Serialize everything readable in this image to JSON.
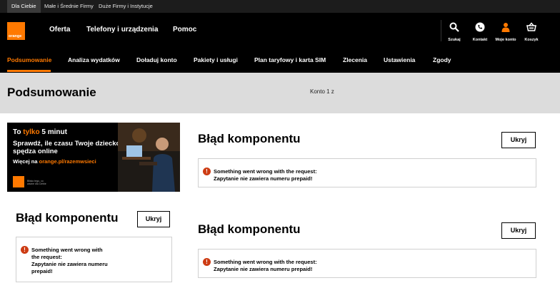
{
  "top_bar": {
    "segments": [
      "Dla Ciebie",
      "Małe i Średnie Firmy",
      "Duże Firmy i Instytucje"
    ]
  },
  "header": {
    "logo_text": "orange",
    "nav": [
      "Oferta",
      "Telefony i urządzenia",
      "Pomoc"
    ],
    "actions": [
      {
        "label": "Szukaj",
        "icon": "search-icon"
      },
      {
        "label": "Kontakt",
        "icon": "phone-icon"
      },
      {
        "label": "Moje konto",
        "icon": "user-icon"
      },
      {
        "label": "Koszyk",
        "icon": "basket-icon"
      }
    ]
  },
  "sub_nav": {
    "items": [
      "Podsumowanie",
      "Analiza wydatków",
      "Doładuj konto",
      "Pakiety i usługi",
      "Plan taryfowy i karta SIM",
      "Zlecenia",
      "Ustawienia",
      "Zgody"
    ],
    "active": "Podsumowanie"
  },
  "page": {
    "title": "Podsumowanie",
    "account": "Konto 1 z"
  },
  "banner": {
    "line1_pre": "To ",
    "line1_highlight": "tylko",
    "line1_post": " 5 minut",
    "line2": "Sprawdź, ile czasu Twoje dziecko spędza online",
    "line3_pre": "Więcej na ",
    "line3_link": "orange.pl/razemwsieci",
    "small_text": "Blisko tego, co ważne dla Ciebie"
  },
  "cards": [
    {
      "title": "Błąd komponentu",
      "hide_label": "Ukryj",
      "message_line1": "Something went wrong with the request:",
      "message_line2": "Zapytanie nie zawiera numeru prepaid!"
    },
    {
      "title": "Błąd komponentu",
      "hide_label": "Ukryj",
      "message_line1": "Something went wrong with",
      "message_line2": "the request:",
      "message_line3": "Zapytanie nie zawiera numeru",
      "message_line4": "prepaid!"
    },
    {
      "title": "Błąd komponentu",
      "hide_label": "Ukryj",
      "message_line1": "Something went wrong with the request:",
      "message_line2": "Zapytanie nie zawiera numeru prepaid!"
    }
  ],
  "colors": {
    "brand": "#ff7900",
    "error": "#cd3c14",
    "header_bg": "#000000",
    "title_bar_bg": "#dcdcdc"
  }
}
